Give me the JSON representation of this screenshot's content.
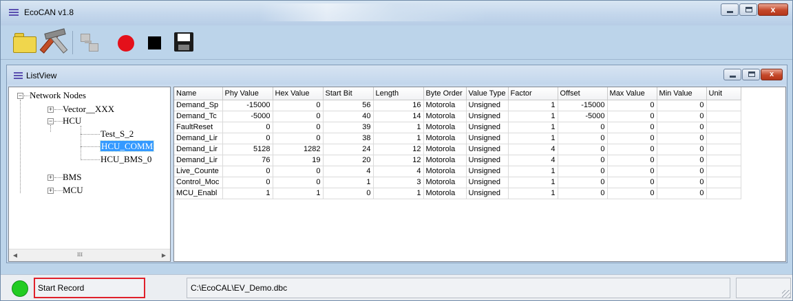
{
  "app": {
    "title": "EcoCAN v1.8"
  },
  "window_controls": {
    "close": "x"
  },
  "child": {
    "title": "ListView"
  },
  "tree": {
    "root": "Network Nodes",
    "items": [
      {
        "label": "Vector__XXX"
      },
      {
        "label": "HCU"
      },
      {
        "label": "Test_S_2"
      },
      {
        "label": "HCU_COMM"
      },
      {
        "label": "HCU_BMS_0"
      },
      {
        "label": "BMS"
      },
      {
        "label": "MCU"
      }
    ],
    "scroll_thumb": "III"
  },
  "grid": {
    "columns": [
      "Name",
      "Phy Value",
      "Hex Value",
      "Start Bit",
      "Length",
      "Byte Order",
      "Value Type",
      "Factor",
      "Offset",
      "Max Value",
      "Min Value",
      "Unit"
    ],
    "rows": [
      [
        "Demand_Sp",
        "-15000",
        "0",
        "56",
        "16",
        "Motorola",
        "Unsigned",
        "1",
        "-15000",
        "0",
        "0",
        ""
      ],
      [
        "Demand_Tc",
        "-5000",
        "0",
        "40",
        "14",
        "Motorola",
        "Unsigned",
        "1",
        "-5000",
        "0",
        "0",
        ""
      ],
      [
        "FaultReset",
        "0",
        "0",
        "39",
        "1",
        "Motorola",
        "Unsigned",
        "1",
        "0",
        "0",
        "0",
        ""
      ],
      [
        "Demand_Lir",
        "0",
        "0",
        "38",
        "1",
        "Motorola",
        "Unsigned",
        "1",
        "0",
        "0",
        "0",
        ""
      ],
      [
        "Demand_Lir",
        "5128",
        "1282",
        "24",
        "12",
        "Motorola",
        "Unsigned",
        "4",
        "0",
        "0",
        "0",
        ""
      ],
      [
        "Demand_Lir",
        "76",
        "19",
        "20",
        "12",
        "Motorola",
        "Unsigned",
        "4",
        "0",
        "0",
        "0",
        ""
      ],
      [
        "Live_Counte",
        "0",
        "0",
        "4",
        "4",
        "Motorola",
        "Unsigned",
        "1",
        "0",
        "0",
        "0",
        ""
      ],
      [
        "Control_Moc",
        "0",
        "0",
        "1",
        "3",
        "Motorola",
        "Unsigned",
        "1",
        "0",
        "0",
        "0",
        ""
      ],
      [
        "MCU_Enabl",
        "1",
        "1",
        "0",
        "1",
        "Motorola",
        "Unsigned",
        "1",
        "0",
        "0",
        "0",
        ""
      ]
    ]
  },
  "statusbar": {
    "indicator_color": "#22cc22",
    "record_label": "Start Record",
    "file_path": "C:\\EcoCAL\\EV_Demo.dbc"
  },
  "icons": {
    "open": "folder-icon",
    "settings": "tools-icon",
    "connect": "plug-icon",
    "record": "record-icon",
    "stop": "stop-icon",
    "save": "save-icon"
  }
}
